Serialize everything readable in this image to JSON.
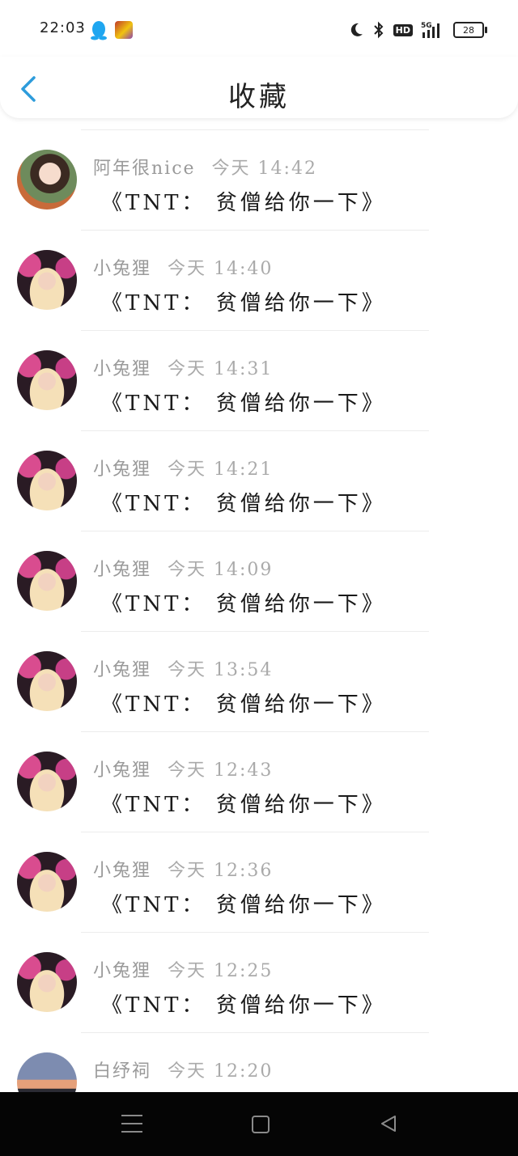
{
  "status_bar": {
    "time": "22:03",
    "qq_icon": "qq-penguin-icon",
    "game_icon": "game-app-icon",
    "signal_label": "5G",
    "hd_label": "HD",
    "battery_level": "28"
  },
  "header": {
    "title": "收藏",
    "back_icon": "chevron-left-icon"
  },
  "favorites": [
    {
      "user": "阿年很nice",
      "time": "今天 14:42",
      "text": "《TNT： 贫僧给你一下》"
    },
    {
      "user": "小兔狸",
      "time": "今天 14:40",
      "text": "《TNT： 贫僧给你一下》"
    },
    {
      "user": "小兔狸",
      "time": "今天 14:31",
      "text": "《TNT： 贫僧给你一下》"
    },
    {
      "user": "小兔狸",
      "time": "今天 14:21",
      "text": "《TNT： 贫僧给你一下》"
    },
    {
      "user": "小兔狸",
      "time": "今天 14:09",
      "text": "《TNT： 贫僧给你一下》"
    },
    {
      "user": "小兔狸",
      "time": "今天 13:54",
      "text": "《TNT： 贫僧给你一下》"
    },
    {
      "user": "小兔狸",
      "time": "今天 12:43",
      "text": "《TNT： 贫僧给你一下》"
    },
    {
      "user": "小兔狸",
      "time": "今天 12:36",
      "text": "《TNT： 贫僧给你一下》"
    },
    {
      "user": "小兔狸",
      "time": "今天 12:25",
      "text": "《TNT： 贫僧给你一下》"
    },
    {
      "user": "白纾祠",
      "time": "今天 12:20",
      "text": ""
    }
  ],
  "nav_bar": {
    "menu_icon": "menu-icon",
    "home_icon": "home-square-icon",
    "back_icon": "back-triangle-icon"
  },
  "colors": {
    "accent": "#2d9cdb",
    "meta_text": "#9a9a9a",
    "nav_background": "#050505"
  }
}
